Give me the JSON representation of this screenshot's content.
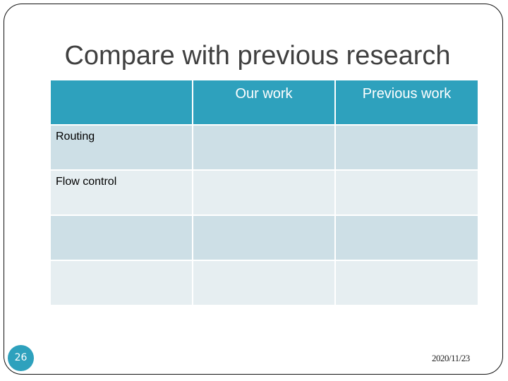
{
  "slide": {
    "title": "Compare with previous research",
    "page_number": "26",
    "date": "2020/11/23"
  },
  "table": {
    "headers": [
      "",
      "Our work",
      "Previous work"
    ],
    "rows": [
      [
        "Routing",
        "",
        ""
      ],
      [
        "Flow control",
        "",
        ""
      ],
      [
        "",
        "",
        ""
      ],
      [
        "",
        "",
        ""
      ]
    ]
  },
  "colors": {
    "accent": "#2ea1bd",
    "row_dark": "#cddfe6",
    "row_light": "#e6eef1",
    "title_text": "#404040"
  }
}
